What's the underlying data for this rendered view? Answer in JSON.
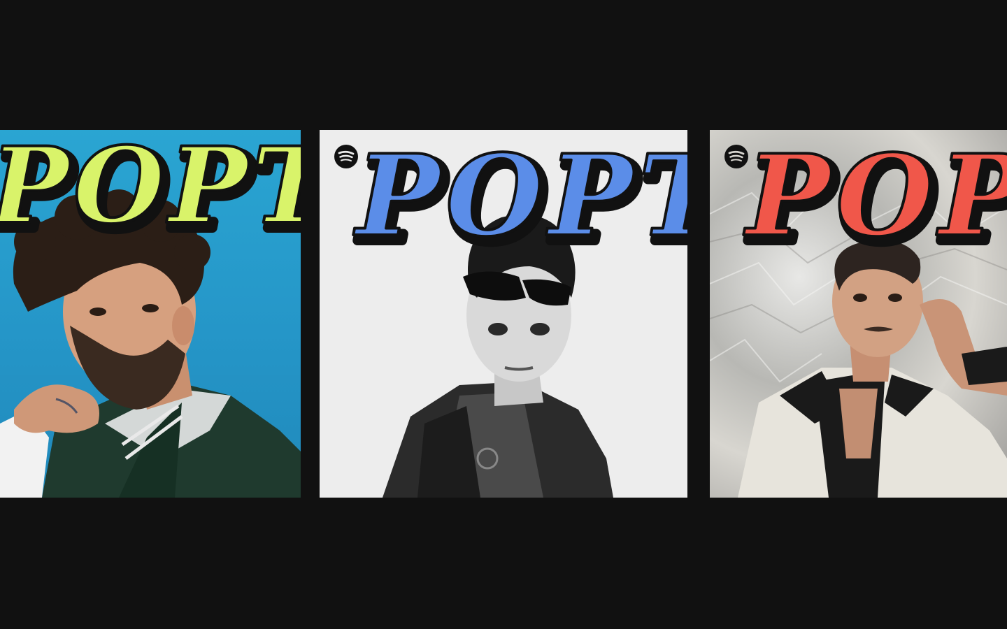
{
  "covers": [
    {
      "logo_text": "POPT",
      "logo_fill": "#d9f36a",
      "background": "#2596c8",
      "show_spotify": false
    },
    {
      "logo_text": "POPT",
      "logo_fill": "#5b8de8",
      "background": "#ededed",
      "show_spotify": true,
      "spotify_icon": "spotify-icon"
    },
    {
      "logo_text": "POPT",
      "logo_fill": "#f0574a",
      "background": "#c9c8c4",
      "show_spotify": true,
      "spotify_icon": "spotify-icon"
    }
  ],
  "colors": {
    "page_background": "#111111",
    "logo_outline": "#111111"
  }
}
